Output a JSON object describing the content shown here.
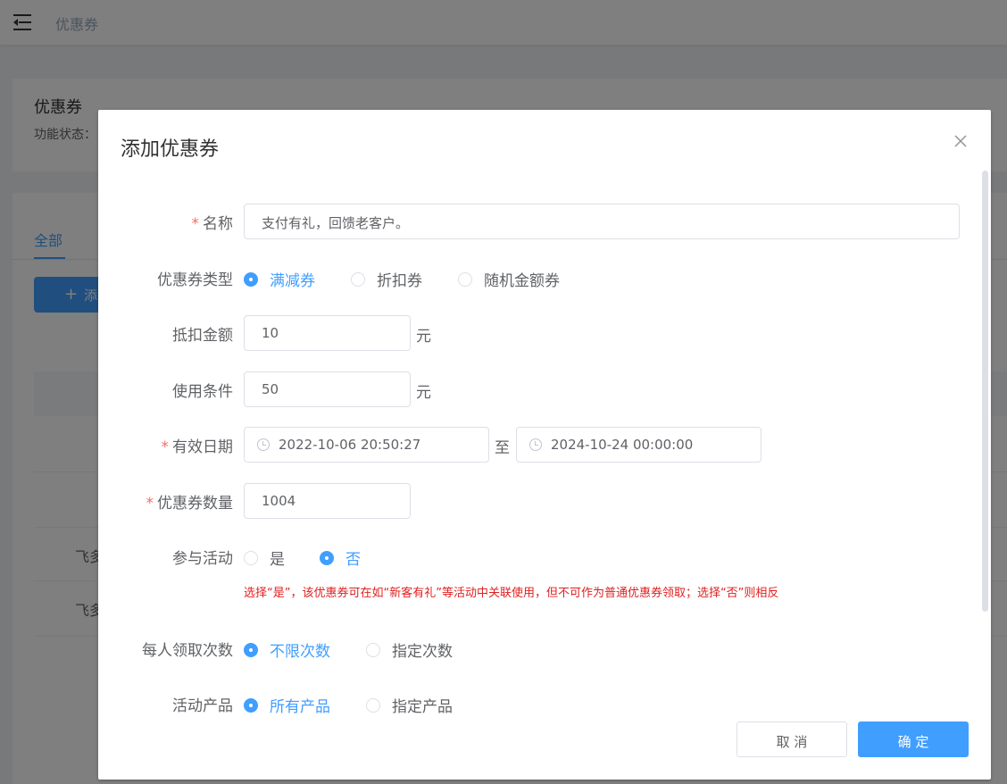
{
  "header": {
    "breadcrumb": "优惠券"
  },
  "page_card": {
    "title": "优惠券",
    "status_label": "功能状态："
  },
  "list": {
    "tab_all": "全部",
    "add_button": "添",
    "rows": [
      "飞多",
      "飞多"
    ]
  },
  "dialog": {
    "title": "添加优惠券",
    "fields": {
      "name": {
        "label": "名称",
        "value": "支付有礼，回馈老客户。"
      },
      "type": {
        "label": "优惠券类型",
        "options": [
          "满减券",
          "折扣券",
          "随机金额券"
        ],
        "selected": "满减券"
      },
      "discount": {
        "label": "抵扣金额",
        "value": "10",
        "unit": "元"
      },
      "condition": {
        "label": "使用条件",
        "value": "50",
        "unit": "元"
      },
      "validity": {
        "label": "有效日期",
        "start": "2022-10-06 20:50:27",
        "separator": "至",
        "end": "2024-10-24 00:00:00"
      },
      "quantity": {
        "label": "优惠券数量",
        "value": "1004"
      },
      "activity": {
        "label": "参与活动",
        "options": [
          "是",
          "否"
        ],
        "selected": "否",
        "hint": "选择“是”，该优惠券可在如“新客有礼”等活动中关联使用，但不可作为普通优惠券领取；选择“否”则相反"
      },
      "per_user": {
        "label": "每人领取次数",
        "options": [
          "不限次数",
          "指定次数"
        ],
        "selected": "不限次数"
      },
      "products": {
        "label": "活动产品",
        "options": [
          "所有产品",
          "指定产品"
        ],
        "selected": "所有产品"
      }
    },
    "cancel_label": "取 消",
    "confirm_label": "确 定"
  },
  "colors": {
    "primary": "#409eff",
    "required": "#f56c6c",
    "hint": "#e02020"
  },
  "icons": {
    "menu": "hamburger-icon",
    "close": "close-icon",
    "time": "clock-icon",
    "plus": "plus-icon"
  }
}
